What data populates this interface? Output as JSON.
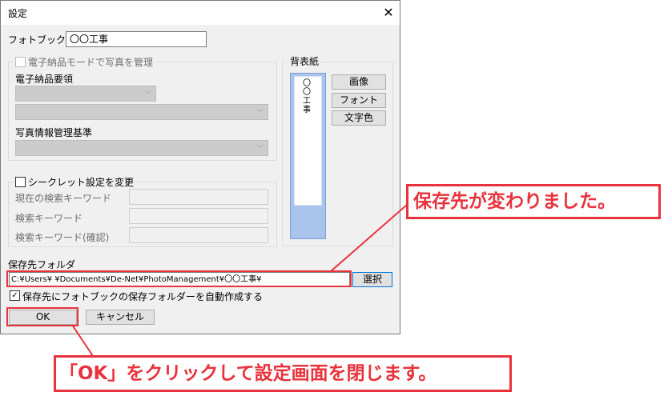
{
  "dialog": {
    "title": "設定",
    "close_glyph": "✕",
    "photobook_label": "フォトブック",
    "photobook_value": "〇〇工事",
    "enotes": {
      "checkbox_label": "電子納品モードで写真を管理",
      "requirement_label": "電子納品要領",
      "standard_label": "写真情報管理基準",
      "arrow": "⌵"
    },
    "secret": {
      "checkbox_label": "シークレット設定を変更",
      "current_label": "現在の検索キーワード",
      "keyword_label": "検索キーワード",
      "confirm_label": "検索キーワード(確認)"
    },
    "cover": {
      "group_label": "背表紙",
      "spine_text": "〇〇工事",
      "image_button": "画像",
      "font_button": "フォント",
      "color_button": "文字色"
    },
    "save": {
      "folder_label": "保存先フォルダ",
      "path_value": "C:¥Users¥            ¥Documents¥De-Net¥PhotoManagement¥〇〇工事¥",
      "select_button": "選択",
      "auto_create_label": "保存先にフォトブックの保存フォルダーを自動作成する"
    },
    "ok_button": "OK",
    "cancel_button": "キャンセル"
  },
  "annotations": {
    "save_changed": "保存先が変わりました。",
    "click_ok": "「OK」をクリックして設定画面を閉じます。"
  },
  "colors": {
    "accent_red": "#e8323c",
    "spine_blue": "#a9c4ec"
  }
}
